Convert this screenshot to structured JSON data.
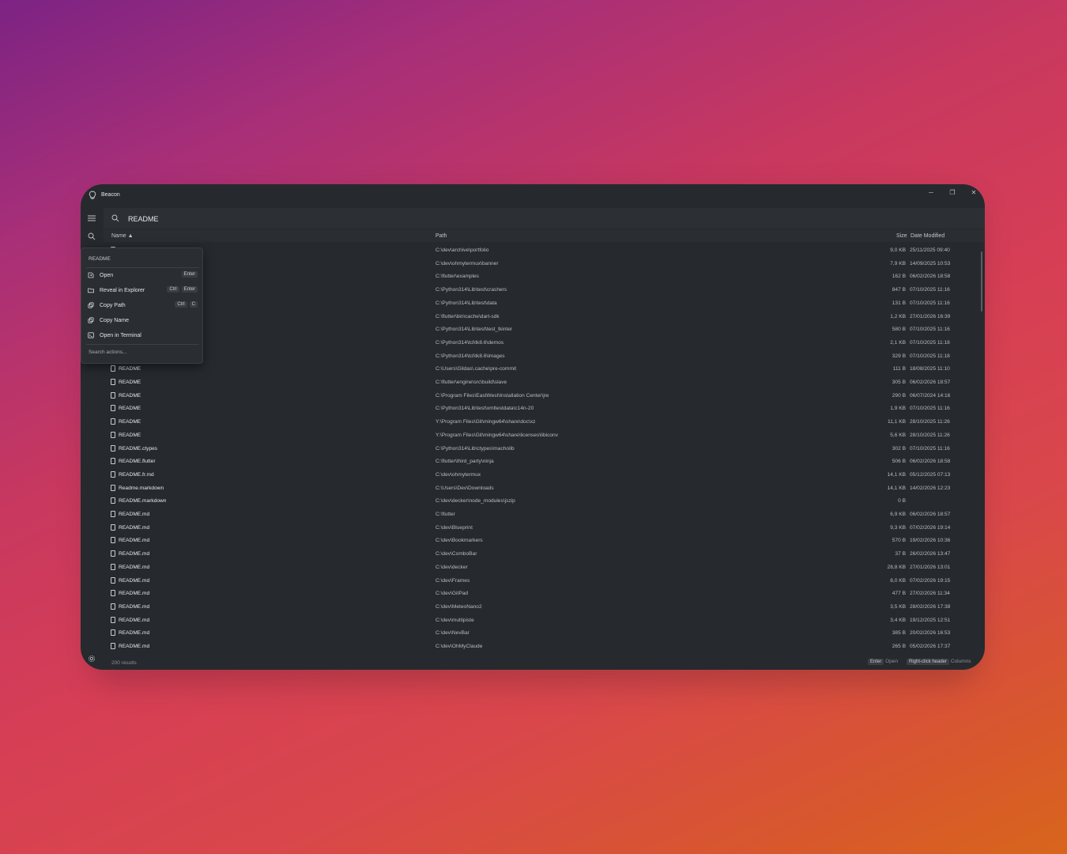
{
  "window": {
    "title": "Beacon"
  },
  "search": {
    "query": "README"
  },
  "columns": {
    "name": "Name ▲",
    "path": "Path",
    "size": "Size",
    "date": "Date Modified"
  },
  "rows": [
    {
      "name": "",
      "path": "C:\\dev\\archive\\portfolio",
      "size": "9,0 KB",
      "date": "25/11/2025 09:40"
    },
    {
      "name": "",
      "path": "C:\\dev\\ohmytermux\\banner",
      "size": "7,9 KB",
      "date": "14/09/2025 10:53"
    },
    {
      "name": "",
      "path": "C:\\flutter\\examples",
      "size": "162 B",
      "date": "06/02/2026 18:58"
    },
    {
      "name": "",
      "path": "C:\\Python314\\Lib\\test\\crashers",
      "size": "847 B",
      "date": "07/10/2025 11:16"
    },
    {
      "name": "",
      "path": "C:\\Python314\\Lib\\test\\data",
      "size": "131 B",
      "date": "07/10/2025 11:16"
    },
    {
      "name": "",
      "path": "C:\\flutter\\bin\\cache\\dart-sdk",
      "size": "1,2 KB",
      "date": "27/01/2026 16:39"
    },
    {
      "name": "",
      "path": "C:\\Python314\\Lib\\test\\test_tkinter",
      "size": "580 B",
      "date": "07/10/2025 11:16"
    },
    {
      "name": "",
      "path": "C:\\Python314\\tcl\\tk8.6\\demos",
      "size": "2,1 KB",
      "date": "07/10/2025 11:18"
    },
    {
      "name": "",
      "path": "C:\\Python314\\tcl\\tk8.6\\images",
      "size": "329 B",
      "date": "07/10/2025 11:18"
    },
    {
      "name": "README",
      "path": "C:\\Users\\Gildas\\.cache\\pre-commit",
      "size": "111 B",
      "date": "18/08/2025 11:10"
    },
    {
      "name": "README",
      "path": "C:\\flutter\\engine\\src\\build\\slave",
      "size": "305 B",
      "date": "06/02/2026 18:57"
    },
    {
      "name": "README",
      "path": "C:\\Program Files\\EastWest\\Installation Center\\jre",
      "size": "290 B",
      "date": "06/07/2024 14:16"
    },
    {
      "name": "README",
      "path": "C:\\Python314\\Lib\\test\\xmltestdata\\c14n-20",
      "size": "1,9 KB",
      "date": "07/10/2025 11:16"
    },
    {
      "name": "README",
      "path": "Y:\\Program Files\\Git\\mingw64\\share\\doc\\xz",
      "size": "11,1 KB",
      "date": "28/10/2025 11:26"
    },
    {
      "name": "README",
      "path": "Y:\\Program Files\\Git\\mingw64\\share\\licenses\\libiconv",
      "size": "5,6 KB",
      "date": "28/10/2025 11:26"
    },
    {
      "name": "README.ctypes",
      "path": "C:\\Python314\\Lib\\ctypes\\macholib",
      "size": "302 B",
      "date": "07/10/2025 11:16"
    },
    {
      "name": "README.flutter",
      "path": "C:\\flutter\\third_party\\ninja",
      "size": "506 B",
      "date": "06/02/2026 18:58"
    },
    {
      "name": "README.fr.md",
      "path": "C:\\dev\\ohmytermux",
      "size": "14,1 KB",
      "date": "05/12/2025 07:13"
    },
    {
      "name": "Readme.markdown",
      "path": "C:\\Users\\Dev\\Downloads",
      "size": "14,1 KB",
      "date": "14/02/2026 12:23"
    },
    {
      "name": "README.markdown",
      "path": "C:\\dev\\decker\\node_modules\\jszip",
      "size": "0 B",
      "date": ""
    },
    {
      "name": "README.md",
      "path": "C:\\flutter",
      "size": "6,9 KB",
      "date": "06/02/2026 18:57"
    },
    {
      "name": "README.md",
      "path": "C:\\dev\\Blueprint",
      "size": "9,3 KB",
      "date": "07/02/2026 19:14"
    },
    {
      "name": "README.md",
      "path": "C:\\dev\\Bookmarkers",
      "size": "570 B",
      "date": "19/02/2026 10:36"
    },
    {
      "name": "README.md",
      "path": "C:\\dev\\ComboBar",
      "size": "37 B",
      "date": "26/02/2026 13:47"
    },
    {
      "name": "README.md",
      "path": "C:\\dev\\decker",
      "size": "28,8 KB",
      "date": "27/01/2026 13:01"
    },
    {
      "name": "README.md",
      "path": "C:\\dev\\Frames",
      "size": "8,0 KB",
      "date": "07/02/2026 19:15"
    },
    {
      "name": "README.md",
      "path": "C:\\dev\\GitPad",
      "size": "477 B",
      "date": "27/02/2026 11:34"
    },
    {
      "name": "README.md",
      "path": "C:\\dev\\MeteoNano2",
      "size": "3,5 KB",
      "date": "28/02/2026 17:38"
    },
    {
      "name": "README.md",
      "path": "C:\\dev\\multipiste",
      "size": "3,4 KB",
      "date": "19/12/2025 12:51"
    },
    {
      "name": "README.md",
      "path": "C:\\dev\\NevBar",
      "size": "385 B",
      "date": "20/02/2026 16:53"
    },
    {
      "name": "README.md",
      "path": "C:\\dev\\OhMyClaude",
      "size": "265 B",
      "date": "05/02/2026 17:37"
    }
  ],
  "context_menu": {
    "title": "README",
    "items": [
      {
        "label": "Open",
        "keys": [
          "Enter"
        ],
        "icon": "open-file-icon"
      },
      {
        "label": "Reveal in Explorer",
        "keys": [
          "Ctrl",
          "Enter"
        ],
        "icon": "folder-icon"
      },
      {
        "label": "Copy Path",
        "keys": [
          "Ctrl",
          "C"
        ],
        "icon": "copy-icon"
      },
      {
        "label": "Copy Name",
        "keys": [],
        "icon": "copy-icon"
      },
      {
        "label": "Open in Terminal",
        "keys": [],
        "icon": "terminal-icon"
      }
    ],
    "search_placeholder": "Search actions..."
  },
  "status": {
    "results": "200 results",
    "hint1_key": "Enter",
    "hint1_text": "Open",
    "hint2_key": "Right-click header",
    "hint2_text": "Columns"
  }
}
